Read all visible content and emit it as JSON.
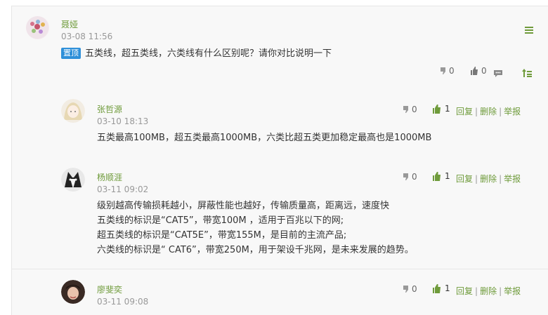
{
  "post": {
    "author": "聂娅",
    "time": "03-08 11:56",
    "badge": "置顶",
    "text": "五类线，超五类线，六类线有什么区别呢？请你对比说明一下",
    "dislikes": "0",
    "likes": "0"
  },
  "replies": [
    {
      "author": "张哲源",
      "time": "03-10 18:13",
      "lines": [
        "五类最高100MB，超五类最高1000MB，六类比超五类更加稳定最高也是1000MB"
      ],
      "dislikes": "0",
      "likes": "1",
      "reply": "回复",
      "delete": "删除",
      "report": "举报"
    },
    {
      "author": "杨顺涯",
      "time": "03-11 09:02",
      "lines": [
        "级别越高传输损耗越小，屏蔽性能也越好，传输质量高，距离远，速度快",
        "五类线的标识是“CAT5”，带宽100M ，适用于百兆以下的网;",
        "超五类线的标识是“CAT5E”，带宽155M，是目前的主流产品;",
        "六类线的标识是“ CAT6”，带宽250M，用于架设千兆网，是未来发展的趋势。"
      ],
      "dislikes": "0",
      "likes": "1",
      "reply": "回复",
      "delete": "删除",
      "report": "举报"
    },
    {
      "author": "廖斐奕",
      "time": "03-11 09:08",
      "lines": [],
      "dislikes": "0",
      "likes": "1",
      "reply": "回复",
      "delete": "删除",
      "report": "举报"
    }
  ],
  "colors": {
    "name": "#6f9b3b",
    "badge": "#2f90d9",
    "like": "#6f9b3b"
  }
}
